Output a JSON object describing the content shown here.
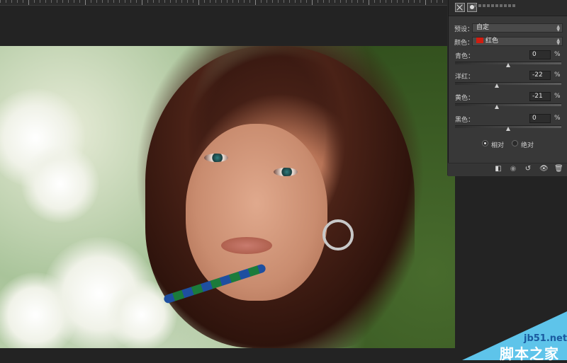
{
  "panel": {
    "preset_label": "预设：",
    "preset_value": "自定",
    "colors_label": "颜色：",
    "colors_value": "红色",
    "colors_swatch": "#d01d10",
    "sliders": [
      {
        "label": "青色：",
        "value": "0",
        "unit": "%",
        "level": 0.5
      },
      {
        "label": "洋红：",
        "value": "-22",
        "unit": "%",
        "level": 0.39
      },
      {
        "label": "黄色：",
        "value": "-21",
        "unit": "%",
        "level": 0.395
      },
      {
        "label": "黑色：",
        "value": "0",
        "unit": "%",
        "level": 0.5
      }
    ],
    "method": {
      "relative_label": "相对",
      "absolute_label": "绝对",
      "selected": "relative"
    },
    "footer_icons": [
      "clip-to-layer-icon",
      "view-previous-icon",
      "reset-icon",
      "visibility-icon",
      "delete-icon"
    ]
  },
  "watermark": {
    "site": "jb51.net",
    "name": "脚本之家"
  }
}
